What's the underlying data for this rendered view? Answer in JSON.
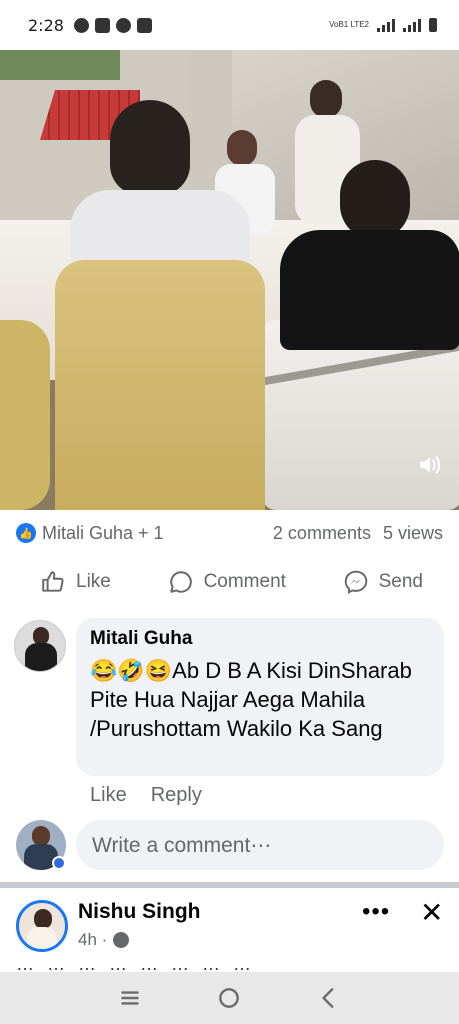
{
  "status_bar": {
    "time": "2:28",
    "volte": "VoB1 LTE2",
    "icons": [
      "whatsapp-icon",
      "youtube-icon",
      "compass-icon",
      "vpn-icon"
    ]
  },
  "video": {
    "volume_icon": "speaker-icon"
  },
  "reactions": {
    "names": "Mitali Guha + 1",
    "comments": "2 comments",
    "views": "5 views"
  },
  "actions": {
    "like": "Like",
    "comment": "Comment",
    "send": "Send"
  },
  "comment": {
    "author": "Mitali Guha",
    "text": "😂🤣😆Ab D B A Kisi DinSharab Pite Hua Najjar Aega Mahila /Purushottam Wakilo Ka Sang",
    "like": "Like",
    "reply": "Reply"
  },
  "write_comment": {
    "placeholder": "Write a comment⋯"
  },
  "next_post": {
    "name": "Nishu Singh",
    "time": "4h ·",
    "more": "•••",
    "close": "✕"
  },
  "colors": {
    "accent": "#1877f2",
    "muted_text": "#65676b",
    "bubble_bg": "#f0f2f5"
  }
}
